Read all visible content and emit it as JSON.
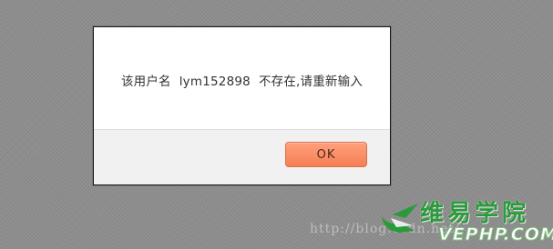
{
  "dialog": {
    "message": "该用户名  lym152898  不存在,请重新输入",
    "ok_label": "OK"
  },
  "watermark": {
    "text": "http://blog.csdn.net/",
    "logo_cn": "维易学院",
    "logo_en": "VEPHP.COM"
  },
  "colors": {
    "backdrop": "#8d8d8d",
    "ok_button": "#f78a63",
    "logo_green": "#2a9a3a"
  }
}
